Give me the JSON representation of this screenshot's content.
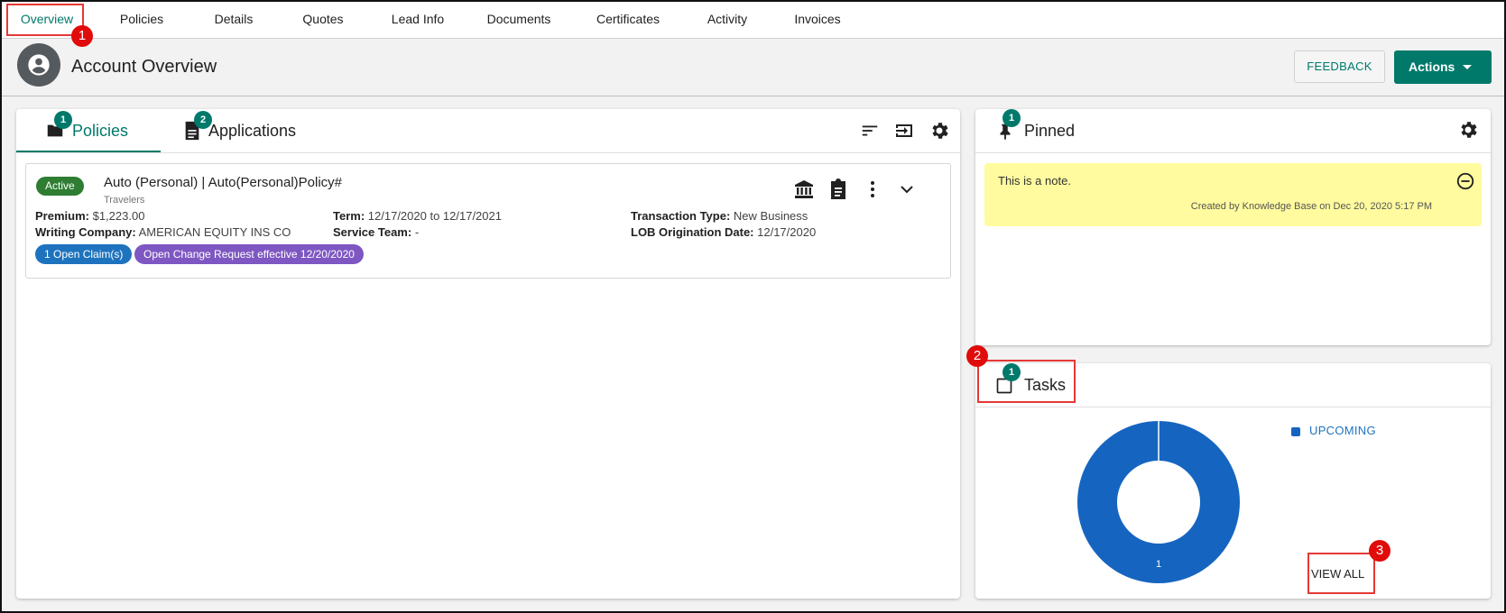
{
  "top_tabs": [
    {
      "label": "Overview",
      "active": true
    },
    {
      "label": "Policies"
    },
    {
      "label": "Details"
    },
    {
      "label": "Quotes"
    },
    {
      "label": "Lead Info"
    },
    {
      "label": "Documents"
    },
    {
      "label": "Certificates"
    },
    {
      "label": "Activity"
    },
    {
      "label": "Invoices"
    }
  ],
  "annotations": {
    "overview": "1",
    "tasks": "2",
    "view_all": "3"
  },
  "header": {
    "title": "Account Overview",
    "feedback_label": "FEEDBACK",
    "actions_label": "Actions"
  },
  "left_panel": {
    "tabs": [
      {
        "label": "Policies",
        "badge": "1",
        "active": true
      },
      {
        "label": "Applications",
        "badge": "2"
      }
    ],
    "policy": {
      "status": "Active",
      "title": "Auto (Personal) | Auto(Personal)Policy#",
      "carrier": "Travelers",
      "premium_label": "Premium:",
      "premium_value": "$1,223.00",
      "writing_company_label": "Writing Company:",
      "writing_company_value": "AMERICAN EQUITY INS CO",
      "term_label": "Term:",
      "term_value": "12/17/2020 to 12/17/2021",
      "service_team_label": "Service Team:",
      "service_team_value": "-",
      "transaction_type_label": "Transaction Type:",
      "transaction_type_value": "New Business",
      "lob_label": "LOB Origination Date:",
      "lob_value": "12/17/2020",
      "chips": [
        "1 Open Claim(s)",
        "Open Change Request effective 12/20/2020"
      ]
    }
  },
  "pinned": {
    "title": "Pinned",
    "badge": "1",
    "note_text": "This is a note.",
    "note_meta": "Created by Knowledge Base on Dec 20, 2020 5:17 PM"
  },
  "tasks": {
    "title": "Tasks",
    "badge": "1",
    "legend": "UPCOMING",
    "view_all": "VIEW ALL"
  },
  "chart_data": {
    "type": "pie",
    "categories": [
      "UPCOMING"
    ],
    "values": [
      1
    ],
    "colors": [
      "#1565c0"
    ],
    "legend": "top-right"
  },
  "colors": {
    "accent": "#00796b",
    "annotation": "#e00b0b",
    "chart_blue": "#1565c0",
    "note_bg": "#fffb9e",
    "status_active": "#2e7d32",
    "chip_claims": "#1e73be",
    "chip_change": "#7e57c2"
  }
}
